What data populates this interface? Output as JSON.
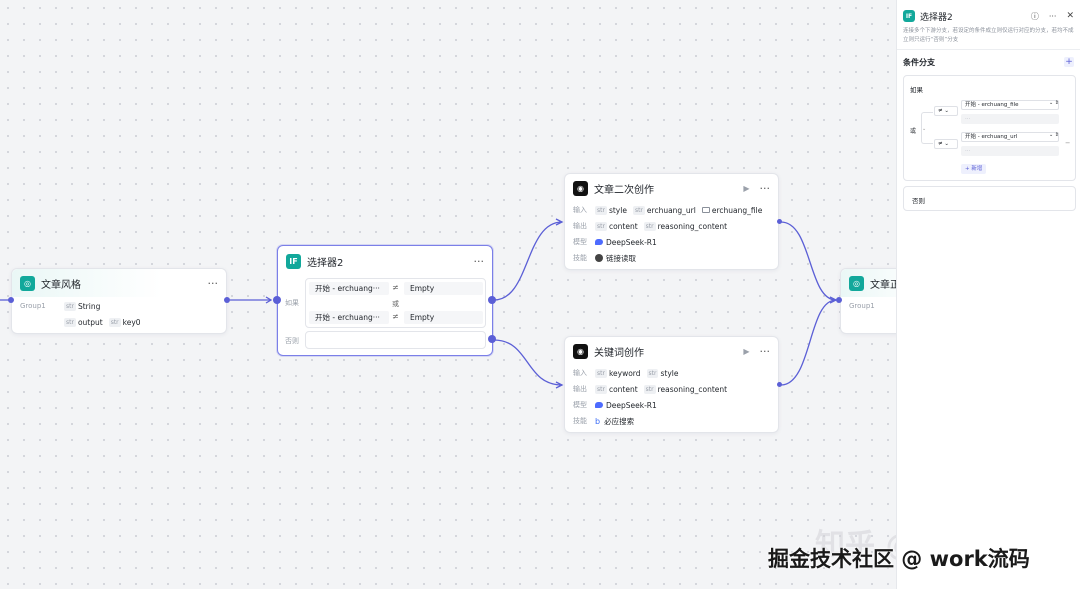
{
  "colors": {
    "accent": "#5b5fd6",
    "teal": "#12a89b",
    "edge": "#5b5fd6"
  },
  "nodes": {
    "style": {
      "title": "文章风格",
      "group_label": "Group1",
      "outputs": [
        {
          "type": "str",
          "name": "String"
        },
        {
          "type": "str",
          "name": "output"
        },
        {
          "type": "str",
          "name": "key0"
        }
      ]
    },
    "selector": {
      "title": "选择器2",
      "if_label": "如果",
      "or_label": "或",
      "else_label": "否则",
      "conditions": [
        {
          "left": "开始 - erchuang···",
          "op": "≠",
          "right": "Empty"
        },
        {
          "left": "开始 - erchuang···",
          "op": "≠",
          "right": "Empty"
        }
      ]
    },
    "rewrite": {
      "title": "文章二次创作",
      "input_label": "输入",
      "output_label": "输出",
      "model_label": "模型",
      "skill_label": "技能",
      "inputs": [
        {
          "type": "str",
          "name": "style"
        },
        {
          "type": "str",
          "name": "erchuang_url"
        },
        {
          "type": "file",
          "name": "erchuang_file"
        }
      ],
      "outputs": [
        {
          "type": "str",
          "name": "content"
        },
        {
          "type": "str",
          "name": "reasoning_content"
        }
      ],
      "model": "DeepSeek-R1",
      "skill": "链接读取"
    },
    "keyword": {
      "title": "关键词创作",
      "input_label": "输入",
      "output_label": "输出",
      "model_label": "模型",
      "skill_label": "技能",
      "inputs": [
        {
          "type": "str",
          "name": "keyword"
        },
        {
          "type": "str",
          "name": "style"
        }
      ],
      "outputs": [
        {
          "type": "str",
          "name": "content"
        },
        {
          "type": "str",
          "name": "reasoning_content"
        }
      ],
      "model": "DeepSeek-R1",
      "skill": "必应搜索"
    },
    "article": {
      "title": "文章正",
      "group_label": "Group1"
    }
  },
  "panel": {
    "title": "选择器2",
    "description": "连接多个下游分支，若设定的条件成立则仅运行对应的分支，若均不成立则只运行“否则”分支",
    "section_title": "条件分支",
    "if_label": "如果",
    "or_label": "或",
    "else_label": "否则",
    "add_label": "+ 新增",
    "conditions": [
      {
        "op": "≠",
        "field": "开始 - erchuang_file"
      },
      {
        "op": "≠",
        "field": "开始 - erchuang_url"
      }
    ],
    "icons": [
      "help-icon",
      "more-icon",
      "close-icon"
    ]
  },
  "watermark": {
    "zhihu": "知乎 @杨哥电商",
    "juejin": "掘金技术社区 @ work流码"
  }
}
